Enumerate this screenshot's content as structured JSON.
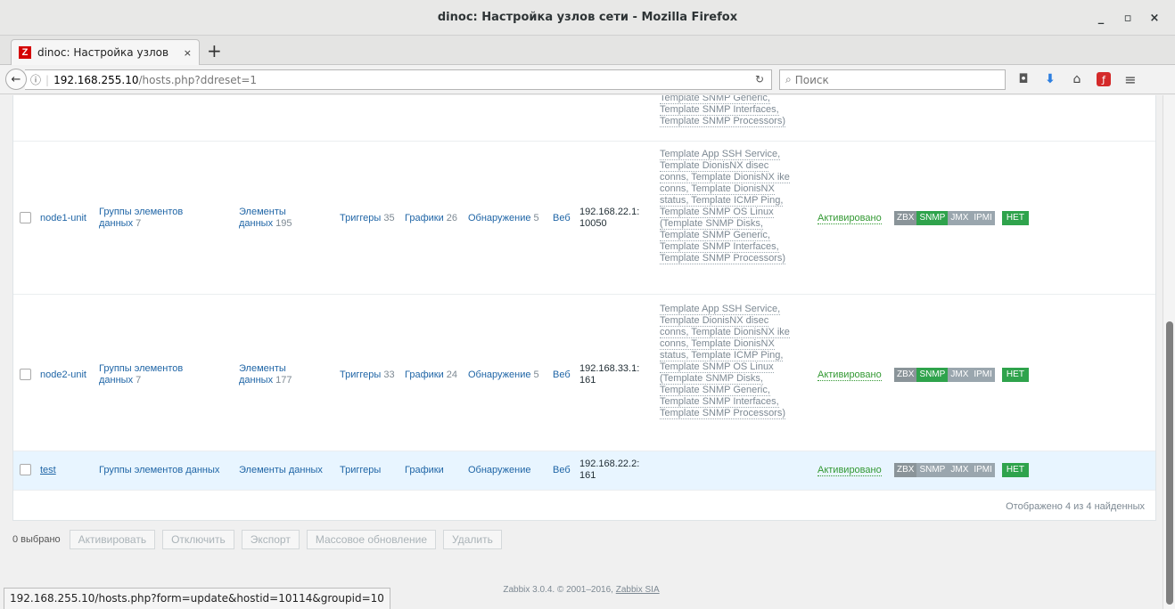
{
  "window": {
    "title": "dinoc: Настройка узлов сети - Mozilla Firefox",
    "minimize": "_",
    "maximize": "▫",
    "close": "×"
  },
  "tab": {
    "favicon": "Z",
    "title": "dinoc: Настройка узлов",
    "close": "×",
    "new_tab": "+"
  },
  "nav": {
    "url_host": "192.168.255.10",
    "url_path": "/hosts.php?ddreset=1",
    "search_placeholder": "Поиск"
  },
  "table": {
    "partial_row": [
      "Template SNMP Generic,",
      "Template SNMP Interfaces,",
      "Template SNMP Processors)"
    ],
    "rows": [
      {
        "name": "node1-unit",
        "groups_label": "Группы элементов",
        "groups_label2": "данных",
        "groups_count": "7",
        "items_label": "Элементы",
        "items_label2": "данных",
        "items_count": "195",
        "triggers_label": "Триггеры",
        "triggers_count": "35",
        "graphs_label": "Графики",
        "graphs_count": "26",
        "discovery_label": "Обнаружение",
        "discovery_count": "5",
        "web_label": "Веб",
        "interface1": "192.168.22.1:",
        "interface2": "10050",
        "templates": [
          "Template App SSH Service,",
          "Template DionisNX disec",
          "conns, Template DionisNX ike",
          "conns, Template DionisNX",
          "status, Template ICMP Ping,",
          "Template SNMP OS Linux",
          "(Template SNMP Disks,",
          "Template SNMP Generic,",
          "Template SNMP Interfaces,",
          "Template SNMP Processors)"
        ],
        "status": "Активировано"
      },
      {
        "name": "node2-unit",
        "groups_label": "Группы элементов",
        "groups_label2": "данных",
        "groups_count": "7",
        "items_label": "Элементы",
        "items_label2": "данных",
        "items_count": "177",
        "triggers_label": "Триггеры",
        "triggers_count": "33",
        "graphs_label": "Графики",
        "graphs_count": "24",
        "discovery_label": "Обнаружение",
        "discovery_count": "5",
        "web_label": "Веб",
        "interface1": "192.168.33.1:",
        "interface2": "161",
        "templates": [
          "Template App SSH Service,",
          "Template DionisNX disec",
          "conns, Template DionisNX ike",
          "conns, Template DionisNX",
          "status, Template ICMP Ping,",
          "Template SNMP OS Linux",
          "(Template SNMP Disks,",
          "Template SNMP Generic,",
          "Template SNMP Interfaces,",
          "Template SNMP Processors)"
        ],
        "status": "Активировано"
      },
      {
        "name": "test",
        "groups_label": "Группы элементов данных",
        "items_label": "Элементы данных",
        "triggers_label": "Триггеры",
        "graphs_label": "Графики",
        "discovery_label": "Обнаружение",
        "web_label": "Веб",
        "interface1": "192.168.22.2:",
        "interface2": "161",
        "status": "Активировано"
      }
    ],
    "availability": [
      "ZBX",
      "SNMP",
      "JMX",
      "IPMI"
    ],
    "encryption": "НЕТ",
    "shown": "Отображено 4 из 4 найденных"
  },
  "actions": {
    "selected": "0 выбрано",
    "activate": "Активировать",
    "disable": "Отключить",
    "export": "Экспорт",
    "mass_update": "Массовое обновление",
    "delete": "Удалить"
  },
  "footer": {
    "copyright": "Zabbix 3.0.4. © 2001–2016,",
    "company": "Zabbix SIA"
  },
  "statusbar": "192.168.255.10/hosts.php?form=update&hostid=10114&groupid=10",
  "colors": {
    "link": "#1f65a6",
    "active_green": "#339933",
    "badge_on": "#2fa34c",
    "badge_off": "#8a9499"
  }
}
